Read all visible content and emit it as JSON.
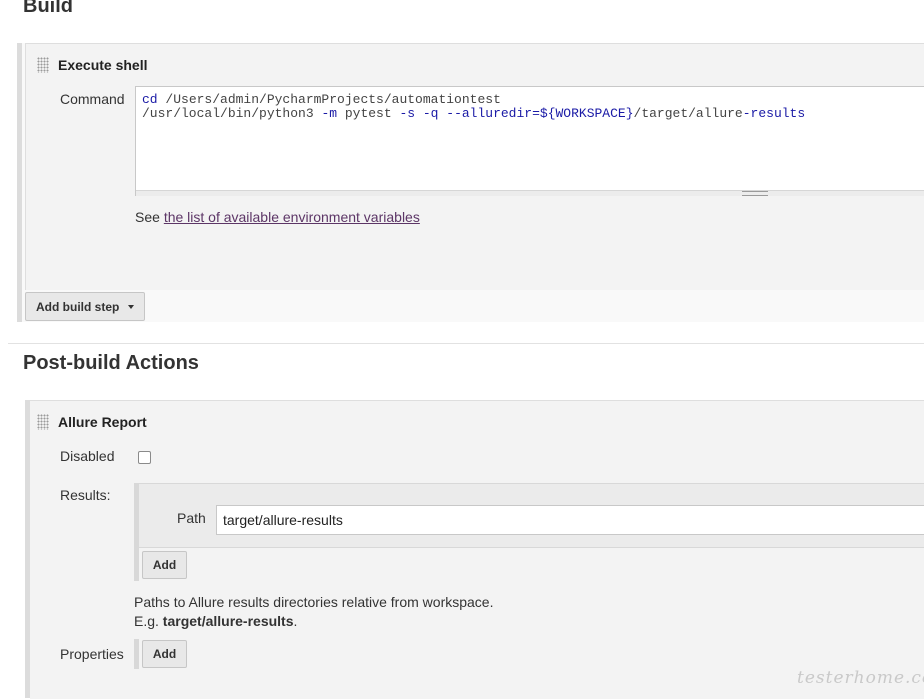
{
  "build": {
    "title": "Build",
    "step": {
      "title": "Execute shell",
      "command_label": "Command",
      "command_line1": "cd /Users/admin/PycharmProjects/automationtest",
      "command_line2_a": "/usr/local/bin/python3 ",
      "command_line2_b": "-m",
      "command_line2_c": " pytest ",
      "command_line2_d": "-s -q --alluredir",
      "command_line2_e": "=${WORKSPACE}",
      "command_line2_f": "/target/allure",
      "command_line2_g": "-results",
      "see_prefix": "See ",
      "env_link": "the list of available environment variables"
    },
    "add_step_label": "Add build step"
  },
  "post_build": {
    "title": "Post-build Actions",
    "allure": {
      "title": "Allure Report",
      "disabled_label": "Disabled",
      "disabled_checked": false,
      "results_label": "Results:",
      "path_label": "Path",
      "path_value": "target/allure-results",
      "add_label": "Add",
      "help_line1": "Paths to Allure results directories relative from workspace.",
      "help_line2_prefix": "E.g. ",
      "help_line2_bold": "target/allure-results",
      "help_line2_suffix": ".",
      "properties_label": "Properties",
      "properties_add_label": "Add"
    }
  },
  "watermark": "testerhome.com",
  "icons": {
    "drag_handle": "drag-handle-icon",
    "dropdown": "caret-down-icon"
  }
}
